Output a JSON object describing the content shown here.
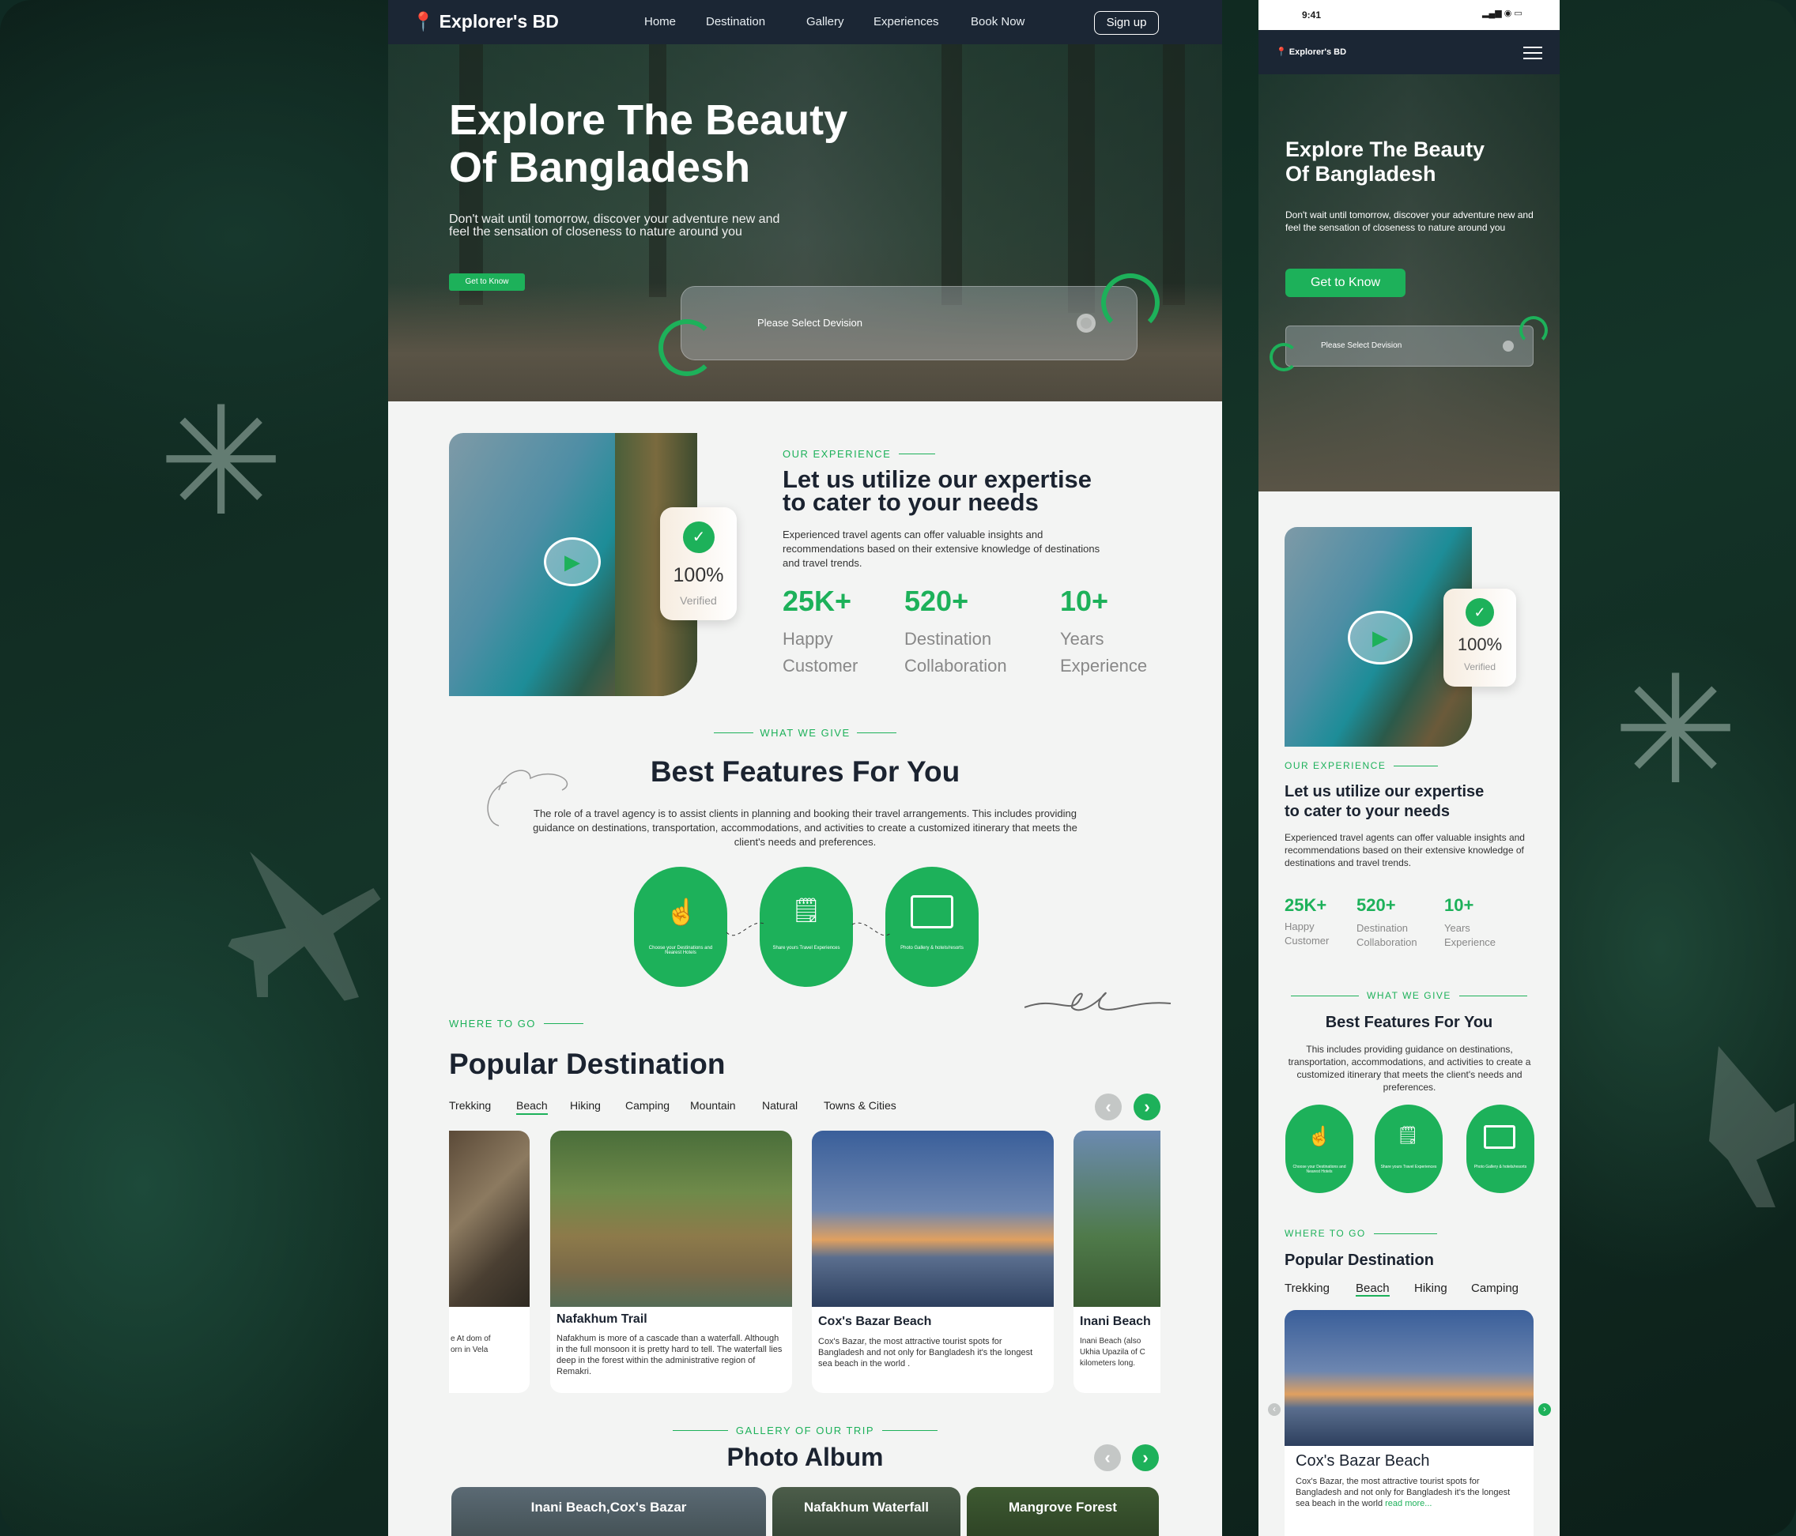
{
  "brand": {
    "name": "Explorer's BD",
    "accent": "#1db15a",
    "dark": "#1b2634"
  },
  "nav": {
    "items": [
      "Home",
      "Destination",
      "Gallery",
      "Experiences",
      "Book Now"
    ],
    "signup": "Sign up"
  },
  "hero": {
    "title_line1": "Explore The Beauty",
    "title_line2": "Of Bangladesh",
    "subtitle": "Don't wait until tomorrow, discover your adventure new and feel the sensation of closeness to nature around you",
    "cta": "Get to Know",
    "select_placeholder": "Please Select Devision"
  },
  "experience": {
    "eyebrow": "OUR EXPERIENCE",
    "title_line1": "Let us utilize our expertise",
    "title_line2": "to cater to your needs",
    "text": "Experienced travel agents can offer valuable insights and recommendations based on their extensive knowledge of destinations and travel trends.",
    "verified_value": "100%",
    "verified_label": "Verified",
    "stats": [
      {
        "value": "25K+",
        "label1": "Happy",
        "label2": "Customer"
      },
      {
        "value": "520+",
        "label1": "Destination",
        "label2": "Collaboration"
      },
      {
        "value": "10+",
        "label1": "Years",
        "label2": "Experience"
      }
    ]
  },
  "features": {
    "eyebrow": "WHAT WE GIVE",
    "title": "Best Features For You",
    "text": "The role of a travel agency is to assist clients in planning and booking their travel arrangements. This includes providing guidance on destinations, transportation, accommodations, and activities to create a customized itinerary that meets the client's needs and preferences.",
    "mobile_text": "This includes providing guidance on destinations, transportation, accommodations, and activities to create a customized itinerary that meets the client's needs and preferences.",
    "items": [
      "Choose your Destinations and Nearest Hotels",
      "Share yours Travel Experiences",
      "Photo Gallery & hotels/resorts"
    ]
  },
  "destinations": {
    "eyebrow": "WHERE TO GO",
    "title": "Popular Destination",
    "tabs": [
      "Trekking",
      "Beach",
      "Hiking",
      "Camping",
      "Mountain",
      "Natural",
      "Towns & Cities"
    ],
    "active_tab": "Beach",
    "cards": [
      {
        "title": "Nafakhum Trail",
        "text": "Nafakhum is more of a cascade than a waterfall. Although in the full monsoon it is pretty hard to tell. The waterfall lies deep in the forest within the administrative region of Remakri."
      },
      {
        "title": "Cox's Bazar Beach",
        "text": "Cox's Bazar, the most attractive tourist spots for Bangladesh and not only for Bangladesh it's the longest sea beach in the world ."
      },
      {
        "title": "Inani Beach",
        "text": "Inani Beach (also Ukhia Upazila of C kilometers long."
      }
    ],
    "partial_card_text": "e At dom of orn in Vela",
    "mobile_card": {
      "title": "Cox's Bazar Beach",
      "text": "Cox's Bazar, the most attractive tourist spots for Bangladesh and not only for Bangladesh it's the longest sea beach in the world",
      "more": "read more..."
    }
  },
  "gallery": {
    "eyebrow": "GALLERY OF OUR TRIP",
    "title": "Photo Album",
    "albums": [
      "Inani Beach,Cox's Bazar",
      "Nafakhum Waterfall",
      "Mangrove Forest"
    ]
  },
  "mobile": {
    "time": "9:41"
  }
}
